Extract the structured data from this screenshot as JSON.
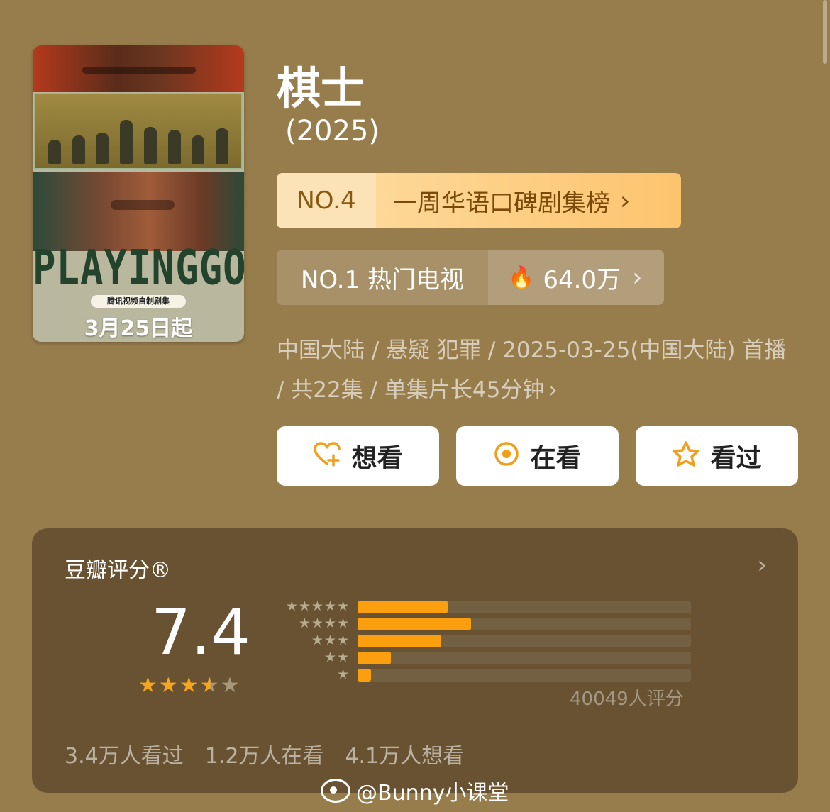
{
  "poster": {
    "title_art": "PLAYING",
    "title_go": "GO",
    "title_cn": "棋士",
    "tagline": "腾讯视频自制剧集",
    "release": "3月25日起"
  },
  "show": {
    "title": "棋士",
    "year": "(2025)"
  },
  "rank_primary": {
    "no": "NO.4",
    "label": "一周华语口碑剧集榜",
    "chevron": "›"
  },
  "rank_secondary": {
    "label": "NO.1 热门电视",
    "heat": "64.0万",
    "chevron": "›"
  },
  "meta": {
    "text": "中国大陆 / 悬疑 犯罪 / 2025-03-25(中国大陆) 首播 / 共22集 / 单集片长45分钟",
    "chevron": "›"
  },
  "actions": [
    {
      "label": "想看",
      "icon": "heart-plus-icon"
    },
    {
      "label": "在看",
      "icon": "target-circle-icon"
    },
    {
      "label": "看过",
      "icon": "star-outline-icon"
    }
  ],
  "rating": {
    "header": "豆瓣评分®",
    "score": "7.4",
    "stars": 3.5,
    "rows": [
      {
        "stars": "★★★★★",
        "fraction": 0.27
      },
      {
        "stars": "★★★★",
        "fraction": 0.34
      },
      {
        "stars": "★★★",
        "fraction": 0.25
      },
      {
        "stars": "★★",
        "fraction": 0.1
      },
      {
        "stars": "★",
        "fraction": 0.04
      }
    ],
    "count": "40049人评分",
    "stats": [
      "3.4万人看过",
      "1.2万人在看",
      "4.1万人想看"
    ]
  },
  "watermark": "@Bunny小课堂",
  "colors": {
    "background": "#987d4c",
    "card": "#685231",
    "accent": "#fb9f0e",
    "rank_gold": "#fdc46e"
  }
}
